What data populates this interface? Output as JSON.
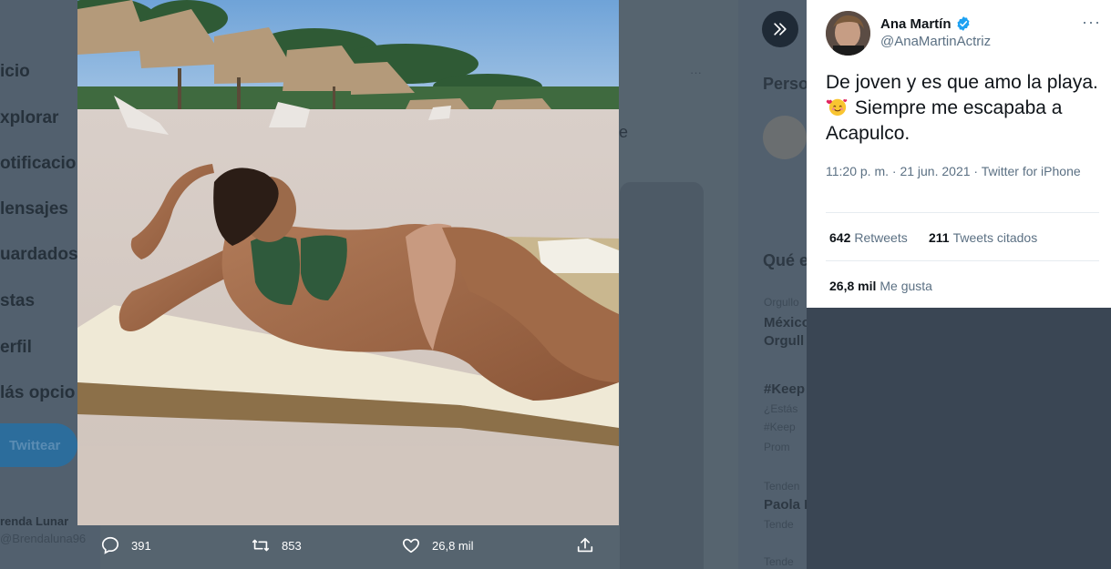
{
  "background": {
    "nav_items": [
      "icio",
      "xplorar",
      "otificacio",
      "lensajes",
      "uardados",
      "stas",
      "erfil",
      "lás opcio"
    ],
    "tweet_button": "Twittear",
    "user_name": "renda Lunar",
    "user_handle": "@Brendaluna96",
    "sidebar": {
      "persons_heading": "Perso",
      "trends_heading": "Qué e",
      "trend1_context": "Orgullo",
      "trend1_line1": "México",
      "trend1_line2": "Orgull",
      "trend2_tag": "#Keep",
      "trend2_line1": "¿Estás",
      "trend2_line2": "#Keep",
      "trend2_promo": "Prom",
      "trend3_context": "Tenden",
      "trend3_name": "Paola I",
      "trend3_sub": "Tende",
      "trend4_context": "Tende"
    },
    "fragment_e": "e"
  },
  "actions": {
    "replies": "391",
    "retweets": "853",
    "likes": "26,8 mil",
    "reply_icon": "reply-icon",
    "retweet_icon": "retweet-icon",
    "like_icon": "heart-icon",
    "share_icon": "share-icon"
  },
  "tweet": {
    "author_name": "Ana Martín",
    "author_handle": "@AnaMartinActriz",
    "text_before_emoji": "De joven y es que amo la playa.",
    "text_after_emoji": "Siempre me escapaba a Acapulco.",
    "emoji": "smiling-face-with-hearts",
    "timestamp": "11:20 p. m. · 21 jun. 2021 · Twitter for iPhone",
    "retweets_count": "642",
    "retweets_label": "Retweets",
    "quotes_count": "211",
    "quotes_label": "Tweets citados",
    "likes_count": "26,8 mil",
    "likes_label": "Me gusta"
  },
  "colors": {
    "accent": "#1da1f2",
    "text_primary": "#0f1419",
    "text_secondary": "#5b7083",
    "overlay": "#52606e"
  }
}
